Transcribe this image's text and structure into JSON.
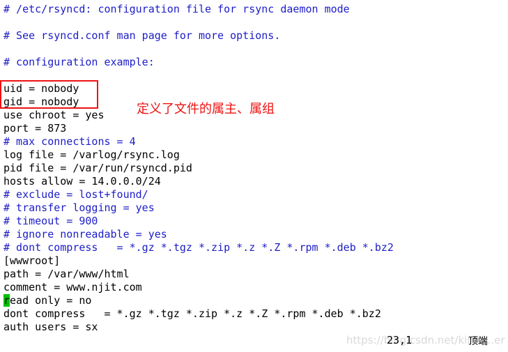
{
  "editor": {
    "lines": [
      {
        "text": "# /etc/rsyncd: configuration file for rsync daemon mode",
        "comment": true
      },
      {
        "text": "",
        "comment": false
      },
      {
        "text": "# See rsyncd.conf man page for more options.",
        "comment": true
      },
      {
        "text": "",
        "comment": false
      },
      {
        "text": "# configuration example:",
        "comment": true
      },
      {
        "text": "",
        "comment": false
      },
      {
        "text": "uid = nobody",
        "comment": false
      },
      {
        "text": "gid = nobody",
        "comment": false
      },
      {
        "text": "use chroot = yes",
        "comment": false
      },
      {
        "text": "port = 873",
        "comment": false
      },
      {
        "text": "# max connections = 4",
        "comment": true
      },
      {
        "text": "log file = /varlog/rsync.log",
        "comment": false
      },
      {
        "text": "pid file = /var/run/rsyncd.pid",
        "comment": false
      },
      {
        "text": "hosts allow = 14.0.0.0/24",
        "comment": false
      },
      {
        "text": "# exclude = lost+found/",
        "comment": true
      },
      {
        "text": "# transfer logging = yes",
        "comment": true
      },
      {
        "text": "# timeout = 900",
        "comment": true
      },
      {
        "text": "# ignore nonreadable = yes",
        "comment": true
      },
      {
        "text": "# dont compress   = *.gz *.tgz *.zip *.z *.Z *.rpm *.deb *.bz2",
        "comment": true
      },
      {
        "text": "[wwwroot]",
        "comment": false
      },
      {
        "text": "path = /var/www/html",
        "comment": false
      },
      {
        "text": "comment = www.njit.com",
        "comment": false
      },
      {
        "text": "read only = no",
        "comment": false
      },
      {
        "text": "dont compress   = *.gz *.tgz *.zip *.z *.Z *.rpm *.deb *.bz2",
        "comment": false
      },
      {
        "text": "auth users = sx",
        "comment": false
      }
    ],
    "cursor_line": 23,
    "cursor_color": "#00c000",
    "comment_color": "#1c1cc8"
  },
  "annotation": {
    "text": "定义了文件的属主、属组",
    "color": "#ee1111"
  },
  "status": {
    "position": "23,1",
    "scroll": "顶端"
  },
  "watermark": "https://blog.csdn.net/kimo…er"
}
